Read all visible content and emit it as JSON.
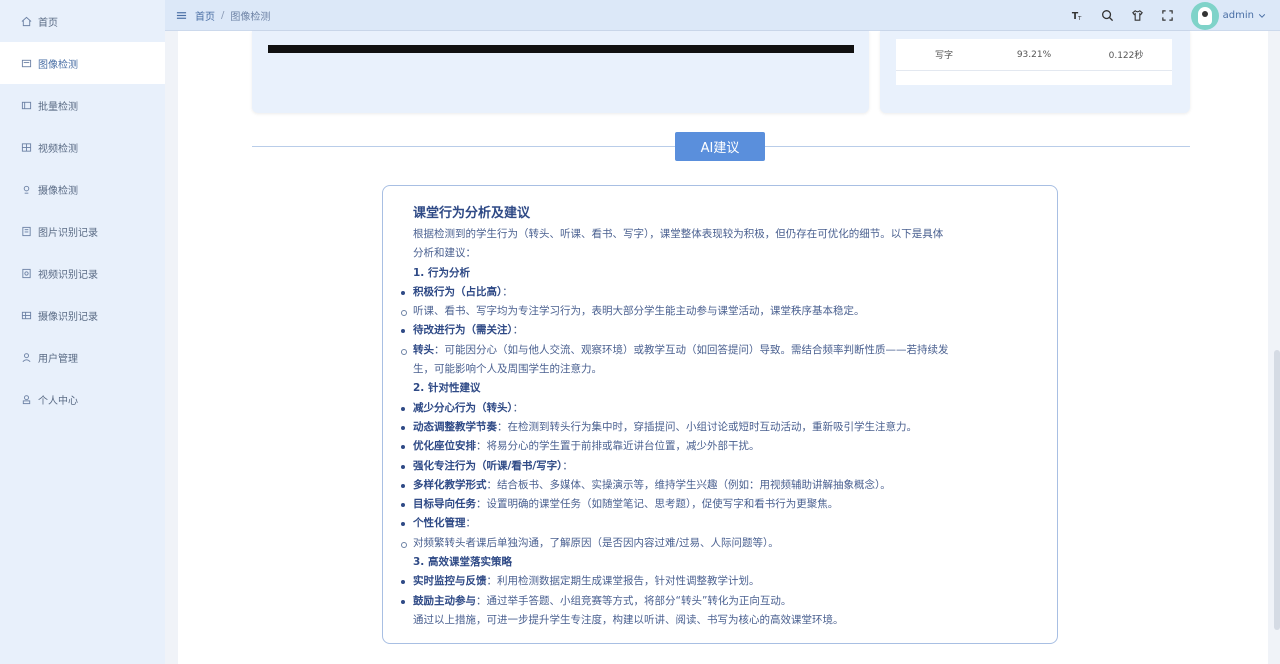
{
  "sidebar": {
    "items": [
      {
        "label": "首页",
        "icon": "home-icon"
      },
      {
        "label": "图像检测",
        "icon": "image-icon"
      },
      {
        "label": "批量检测",
        "icon": "batch-icon"
      },
      {
        "label": "视频检测",
        "icon": "video-icon"
      },
      {
        "label": "摄像检测",
        "icon": "camera-icon"
      },
      {
        "label": "图片识别记录",
        "icon": "image-record-icon"
      },
      {
        "label": "视频识别记录",
        "icon": "video-record-icon"
      },
      {
        "label": "摄像识别记录",
        "icon": "camera-record-icon"
      },
      {
        "label": "用户管理",
        "icon": "user-icon"
      },
      {
        "label": "个人中心",
        "icon": "person-icon"
      }
    ],
    "active_index": 1
  },
  "header": {
    "breadcrumb": [
      "首页",
      "图像检测"
    ],
    "separator": "/",
    "user_name": "admin"
  },
  "stats": {
    "rows": [
      {
        "behavior": "写字",
        "confidence": "93.21%",
        "time": "0.122秒"
      }
    ]
  },
  "ai": {
    "badge": "AI建议",
    "title": "课堂行为分析及建议",
    "intro1": "根据检测到的学生行为（转头、听课、看书、写字），课堂整体表现较为积极，但仍存在可优化的细节。以下是具体",
    "intro2": "分析和建议：",
    "s1": "1. 行为分析",
    "b1_bold": "积极行为（占比高）",
    "b1_rest": "：",
    "b1_text": "听课、看书、写字均为专注学习行为，表明大部分学生能主动参与课堂活动，课堂秩序基本稳定。",
    "b2_bold": "待改进行为（需关注）",
    "b2_rest": "：",
    "b2_sub_bold": "转头",
    "b2_sub_text1": "：可能因分心（如与他人交流、观察环境）或教学互动（如回答提问）导致。需结合频率判断性质——若持续发",
    "b2_sub_text2": "生，可能影响个人及周围学生的注意力。",
    "s2": "2. 针对性建议",
    "c1_bold": "减少分心行为（转头）",
    "c1_rest": "：",
    "c1a_bold": "动态调整教学节奏",
    "c1a_text": "：在检测到转头行为集中时，穿插提问、小组讨论或短时互动活动，重新吸引学生注意力。",
    "c1b_bold": "优化座位安排",
    "c1b_text": "：将易分心的学生置于前排或靠近讲台位置，减少外部干扰。",
    "c2_bold": "强化专注行为（听课/看书/写字）",
    "c2_rest": "：",
    "c2a_bold": "多样化教学形式",
    "c2a_text": "：结合板书、多媒体、实操演示等，维持学生兴趣（例如：用视频辅助讲解抽象概念）。",
    "c2b_bold": "目标导向任务",
    "c2b_text": "：设置明确的课堂任务（如随堂笔记、思考题），促使写字和看书行为更聚焦。",
    "c3_bold": "个性化管理",
    "c3_rest": "：",
    "c3_text": "对频繁转头者课后单独沟通，了解原因（是否因内容过难/过易、人际问题等）。",
    "s3": "3. 高效课堂落实策略",
    "d1_bold": "实时监控与反馈",
    "d1_text": "：利用检测数据定期生成课堂报告，针对性调整教学计划。",
    "d2_bold": "鼓励主动参与",
    "d2_text": "：通过举手答题、小组竞赛等方式，将部分“转头”转化为正向互动。",
    "conclusion": "通过以上措施，可进一步提升学生专注度，构建以听讲、阅读、书写为核心的高效课堂环境。"
  },
  "colors": {
    "accent": "#5a8fdc",
    "sidebar_bg": "#e8f0fb",
    "header_bg": "#dce8f8"
  }
}
